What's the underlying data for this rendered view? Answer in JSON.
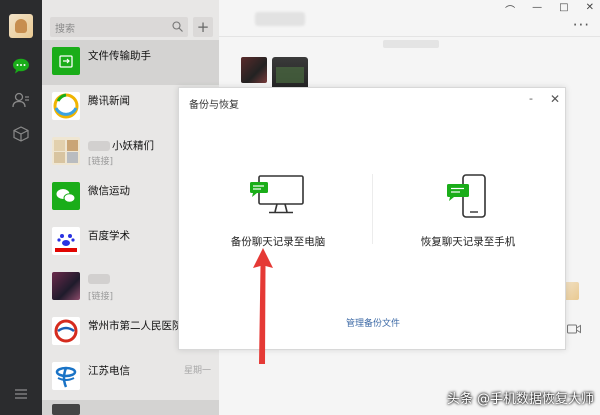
{
  "search": {
    "placeholder": "搜索"
  },
  "chats": [
    {
      "name": "文件传输助手",
      "sub": "",
      "time": ""
    },
    {
      "name": "腾讯新闻",
      "sub": "",
      "time": ""
    },
    {
      "name": "小妖精们",
      "sub": "[链接]",
      "time": ""
    },
    {
      "name": "微信运动",
      "sub": "",
      "time": ""
    },
    {
      "name": "百度学术",
      "sub": "",
      "time": ""
    },
    {
      "name": "",
      "sub": "[链接]",
      "time": ""
    },
    {
      "name": "常州市第二人民医院",
      "sub": "",
      "time": ""
    },
    {
      "name": "江苏电信",
      "sub": "",
      "time": "星期一"
    }
  ],
  "window": {
    "pin": "⌒",
    "minimize": "—",
    "maximize": "□",
    "close": "✕",
    "more": "···"
  },
  "dialog": {
    "title": "备份与恢复",
    "minimize": "-",
    "close": "✕",
    "backup_pc_label": "备份聊天记录至电脑",
    "restore_phone_label": "恢复聊天记录至手机",
    "manage_link": "管理备份文件"
  },
  "watermark": "头条 @手机数据恢复大师",
  "colors": {
    "wechat_green": "#1aad19",
    "rail_bg": "#2b2c2e",
    "arrow_red": "#e53935",
    "link_blue": "#3d6aa6"
  }
}
